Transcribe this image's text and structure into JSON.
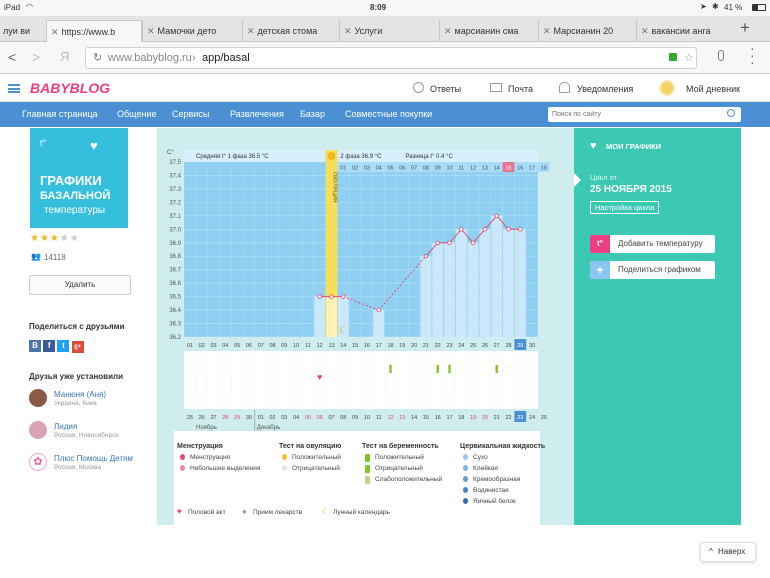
{
  "status_bar": {
    "device": "iPad",
    "time": "8:09",
    "battery": "41 %"
  },
  "browser": {
    "tabs": [
      {
        "label": "луи ви"
      },
      {
        "label": "https://www.b"
      },
      {
        "label": "Мамочки дето"
      },
      {
        "label": "детская стома"
      },
      {
        "label": "Услуги"
      },
      {
        "label": "марсианин сма"
      },
      {
        "label": "Марсианин 20"
      },
      {
        "label": "вакансии анга"
      }
    ],
    "new_tab": "+",
    "back": "<",
    "forward": ">",
    "search_glyph": "Я",
    "url_host": "www.babyblog.ru",
    "url_sep": "›",
    "url_path": "app/basal"
  },
  "site": {
    "logo": "BABYBLOG",
    "header_links": [
      {
        "label": "Ответы"
      },
      {
        "label": "Почта"
      },
      {
        "label": "Уведомления"
      },
      {
        "label": "Мой дневник"
      }
    ],
    "nav": [
      {
        "label": "Главная страница"
      },
      {
        "label": "Общение"
      },
      {
        "label": "Сервисы"
      },
      {
        "label": "Развлечения"
      },
      {
        "label": "Базар"
      },
      {
        "label": "Совместные покупки"
      }
    ],
    "search_placeholder": "Поиск по сайту"
  },
  "app": {
    "banner": {
      "temp_sign": "t°",
      "line1": "ГРАФИКИ",
      "line2": "БАЗАЛЬНОЙ",
      "line3": "температуры"
    },
    "rating": 3,
    "max_rating": 5,
    "users_count": "14118",
    "delete_label": "Удалить",
    "share_title": "Поделиться с друзьями",
    "share_icons": [
      "vk-icon",
      "facebook-icon",
      "twitter-icon",
      "gplus-icon"
    ],
    "share_letters": [
      "В",
      "f",
      "t",
      "g+"
    ],
    "friends_title": "Друзья уже установили",
    "friends": [
      {
        "name": "Манюня (Аня)",
        "location": "Украина, Киев"
      },
      {
        "name": "Лидия",
        "location": "Россия, Новосибирск"
      },
      {
        "name": "Плюс Помощь Детям",
        "location": "Россия, Москва"
      }
    ]
  },
  "sidebar": {
    "title": "МОИ ГРАФИКИ",
    "cycle_label": "Цикл от",
    "cycle_date": "25 НОЯБРЯ 2015",
    "settings_label": "Настройка цикла",
    "add_temp_label": "Добавить температуру",
    "share_chart_label": "Поделиться графиком"
  },
  "chart_data": {
    "type": "line",
    "y_unit": "C°",
    "ylim": [
      36.2,
      37.5
    ],
    "y_ticks": [
      "37.5",
      "37.4",
      "37.3",
      "37.2",
      "37.1",
      "37.0",
      "36.9",
      "36.8",
      "36.7",
      "36.6",
      "36.5",
      "36.4",
      "36.3",
      "36.2"
    ],
    "phase1_label": "Средняя t° 1 фаза 36.5 °С",
    "phase2_label": "2 фаза 36.9 °С",
    "diff_label": "Разница t° 0.4 °С",
    "ovulation_label": "ОВУЛЯЦИЯ",
    "cycle_days": [
      "01",
      "02",
      "03",
      "04",
      "05",
      "06",
      "07",
      "08",
      "09",
      "10",
      "11",
      "12",
      "13",
      "14",
      "15",
      "16",
      "17",
      "18",
      "19",
      "20",
      "21",
      "22",
      "23",
      "24",
      "25",
      "26",
      "27",
      "28",
      "29",
      "30"
    ],
    "phase2_day_numbers": [
      "01",
      "02",
      "03",
      "04",
      "05",
      "06",
      "07",
      "08",
      "09",
      "10",
      "11",
      "12",
      "13",
      "14",
      "15",
      "16",
      "17",
      "18"
    ],
    "highlight_phase_day": "15",
    "current_cycle_day": "29",
    "ovulation_day": "13",
    "measurements": [
      {
        "day": "12",
        "temp": 36.5
      },
      {
        "day": "13",
        "temp": 36.5
      },
      {
        "day": "14",
        "temp": 36.5
      },
      {
        "day": "17",
        "temp": 36.4
      },
      {
        "day": "21",
        "temp": 36.8
      },
      {
        "day": "22",
        "temp": 36.9
      },
      {
        "day": "23",
        "temp": 36.9
      },
      {
        "day": "24",
        "temp": 37.0
      },
      {
        "day": "25",
        "temp": 36.9
      },
      {
        "day": "26",
        "temp": 37.0
      },
      {
        "day": "27",
        "temp": 37.1
      },
      {
        "day": "28",
        "temp": 37.0
      },
      {
        "day": "29",
        "temp": 37.0
      }
    ],
    "intercourse_day": "12",
    "moon_day": "14",
    "pregnancy_test_days": [
      "18",
      "22",
      "23",
      "27"
    ],
    "dates": [
      "25",
      "26",
      "27",
      "28",
      "29",
      "30",
      "01",
      "02",
      "03",
      "04",
      "05",
      "06",
      "07",
      "08",
      "09",
      "10",
      "11",
      "12",
      "13",
      "14",
      "15",
      "16",
      "17",
      "18",
      "19",
      "20",
      "21",
      "22",
      "23",
      "24",
      "25"
    ],
    "weekend_dates": [
      "28",
      "29",
      "05",
      "06",
      "12",
      "13",
      "19",
      "20"
    ],
    "current_date": "23",
    "month_labels": [
      "Ноябрь",
      "Декабрь"
    ]
  },
  "legend": {
    "groups": [
      {
        "title": "Менструация",
        "items": [
          "Менструация",
          "Небольшие выделения"
        ]
      },
      {
        "title": "Тест на овуляцию",
        "items": [
          "Положительный",
          "Отрицательный"
        ]
      },
      {
        "title": "Тест на беременность",
        "items": [
          "Положительный",
          "Отрицательный",
          "Слабоположительный"
        ]
      },
      {
        "title": "Цервикальная жидкость",
        "items": [
          "Сухо",
          "Клейкая",
          "Кремообразная",
          "Водянистая",
          "Яичный белок"
        ]
      }
    ],
    "extras": [
      "Половой акт",
      "Прием лекарств",
      "Лунный календарь"
    ]
  },
  "back_to_top": "Наверх",
  "colors": {
    "brand": "#ed3e84",
    "nav": "#4a90d2",
    "chart_bar": "#cbe8fb",
    "chart_bg": "#8fd0f2",
    "teal": "#3bc9b3",
    "line": "#e24b6e",
    "ovulation": "#f6de5b"
  }
}
